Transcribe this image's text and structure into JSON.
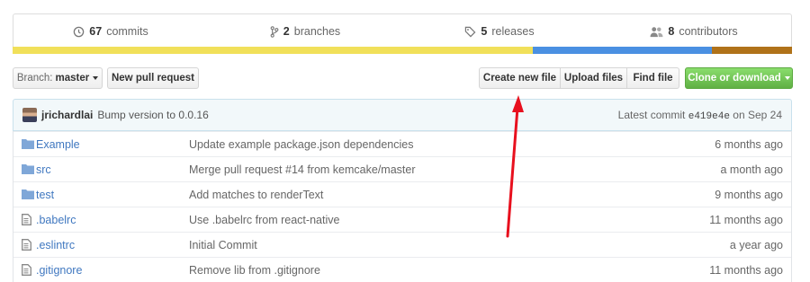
{
  "summary": {
    "commits": {
      "count": "67",
      "label": "commits",
      "icon": "history-icon"
    },
    "branches": {
      "count": "2",
      "label": "branches",
      "icon": "branch-icon"
    },
    "releases": {
      "count": "5",
      "label": "releases",
      "icon": "tag-icon"
    },
    "contributors": {
      "count": "8",
      "label": "contributors",
      "icon": "people-icon"
    }
  },
  "language_bar": [
    {
      "color": "#f1e05a",
      "fraction": 0.667
    },
    {
      "color": "#4a90e2",
      "fraction": 0.23
    },
    {
      "color": "#b07219",
      "fraction": 0.103
    }
  ],
  "toolbar": {
    "branch_prefix": "Branch:",
    "branch_name": "master",
    "new_pull_request": "New pull request",
    "create_new_file": "Create new file",
    "upload_files": "Upload files",
    "find_file": "Find file",
    "clone_or_download": "Clone or download"
  },
  "latest_commit": {
    "author": "jrichardlai",
    "message": "Bump version to 0.0.16",
    "prefix": "Latest commit",
    "sha": "e419e4e",
    "date": "on Sep 24"
  },
  "files": [
    {
      "type": "folder",
      "name": "Example",
      "message": "Update example package.json dependencies",
      "age": "6 months ago"
    },
    {
      "type": "folder",
      "name": "src",
      "message": "Merge pull request #14 from kemcake/master",
      "age": "a month ago"
    },
    {
      "type": "folder",
      "name": "test",
      "message": "Add matches to renderText",
      "age": "9 months ago"
    },
    {
      "type": "file",
      "name": ".babelrc",
      "message": "Use .babelrc from react-native",
      "age": "11 months ago"
    },
    {
      "type": "file",
      "name": ".eslintrc",
      "message": "Initial Commit",
      "age": "a year ago"
    },
    {
      "type": "file",
      "name": ".gitignore",
      "message": "Remove lib from .gitignore",
      "age": "11 months ago"
    }
  ],
  "annotation": {
    "color": "#e8101e"
  }
}
